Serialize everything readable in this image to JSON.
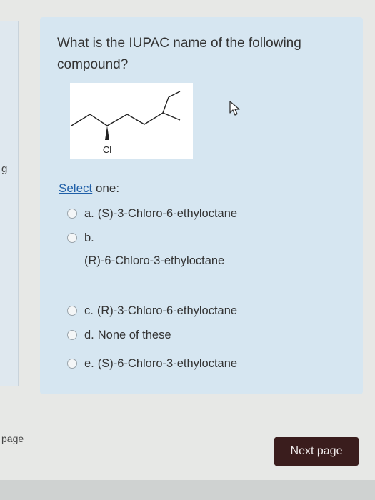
{
  "question": {
    "side_number": "g",
    "text": "What is the IUPAC name of the following compound?",
    "structure_label": "Cl",
    "select_word": "Select",
    "select_rest": " one:"
  },
  "options": {
    "a": {
      "letter": "a.",
      "text": "(S)-3-Chloro-6-ethyloctane"
    },
    "b": {
      "letter": "b.",
      "text": "(R)-6-Chloro-3-ethyloctane"
    },
    "c": {
      "letter": "c.",
      "text": "(R)-3-Chloro-6-ethyloctane"
    },
    "d": {
      "letter": "d.",
      "text": "None of these"
    },
    "e": {
      "letter": "e.",
      "text": "(S)-6-Chloro-3-ethyloctane"
    }
  },
  "footer": {
    "left_label": "page",
    "next_button": "Next page"
  },
  "colors": {
    "card_background": "#d6e6f1",
    "button_background": "#3a1d1d",
    "link": "#1f5fa8"
  }
}
